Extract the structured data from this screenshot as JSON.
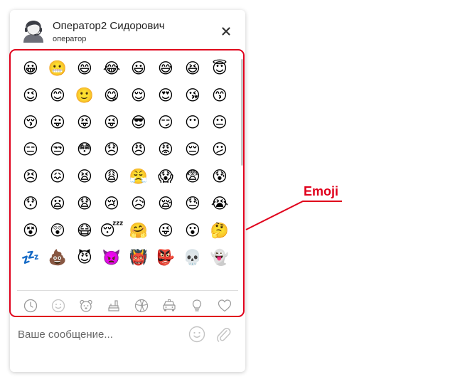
{
  "header": {
    "operator_name": "Оператор2 Сидорович",
    "operator_role": "оператор",
    "avatar_icon": "operator-headset-avatar-icon",
    "close_icon": "close-icon"
  },
  "emoji_picker": {
    "emojis": [
      "😀",
      "😬",
      "😄",
      "😂",
      "😃",
      "😅",
      "😆",
      "😇",
      "😉",
      "😊",
      "🙂",
      "😋",
      "😌",
      "😍",
      "😘",
      "😙",
      "😚",
      "😛",
      "😝",
      "😜",
      "😎",
      "😏",
      "😶",
      "😐",
      "😑",
      "😒",
      "😳",
      "😞",
      "😠",
      "😡",
      "😔",
      "😕",
      "😣",
      "😖",
      "😫",
      "😩",
      "😤",
      "😱",
      "😨",
      "😰",
      "😯",
      "😦",
      "😧",
      "😢",
      "😥",
      "😪",
      "😓",
      "😭",
      "😵",
      "😲",
      "😷",
      "😴",
      "🤗",
      "😜",
      "😮",
      "🤔",
      "💤",
      "💩",
      "😈",
      "👿",
      "👹",
      "👺",
      "💀",
      "👻"
    ],
    "categories": [
      {
        "icon": "clock-icon",
        "active": true
      },
      {
        "icon": "smiley-face-icon",
        "active": false
      },
      {
        "icon": "bear-animal-icon",
        "active": true
      },
      {
        "icon": "food-icon",
        "active": true
      },
      {
        "icon": "ball-icon",
        "active": true
      },
      {
        "icon": "car-icon",
        "active": true
      },
      {
        "icon": "lightbulb-icon",
        "active": true
      },
      {
        "icon": "heart-icon",
        "active": true
      }
    ]
  },
  "composer": {
    "placeholder": "Ваше сообщение...",
    "smile_icon": "smile-icon",
    "attach_icon": "paperclip-icon"
  },
  "annotation": {
    "label": "Emoji",
    "color": "#e0001b"
  },
  "colors": {
    "icon_gray": "#9a9a9a",
    "icon_light": "#c4c4c4",
    "accent_red": "#e0001b"
  }
}
